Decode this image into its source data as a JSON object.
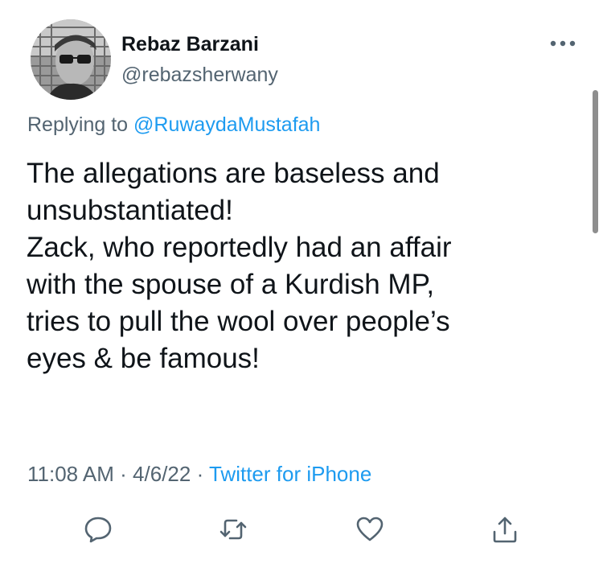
{
  "user": {
    "display_name": "Rebaz Barzani",
    "handle": "@rebazsherwany",
    "avatar_icon": "profile-photo"
  },
  "reply": {
    "prefix": "Replying to ",
    "mention": "@RuwaydaMustafah"
  },
  "tweet": {
    "lines": [
      "The allegations are baseless and",
      "unsubstantiated!",
      "Zack, who reportedly had an affair",
      "with the spouse of a Kurdish MP,",
      "tries to pull the wool over people’s",
      "eyes & be famous!"
    ]
  },
  "meta": {
    "time": "11:08 AM",
    "separator": " · ",
    "date": "4/6/22",
    "source": "Twitter for iPhone"
  },
  "actions": {
    "reply_icon": "reply-icon",
    "retweet_icon": "retweet-icon",
    "like_icon": "heart-icon",
    "share_icon": "share-icon"
  },
  "colors": {
    "text_primary": "#0f1419",
    "text_secondary": "#536471",
    "link": "#1d9bf0"
  }
}
